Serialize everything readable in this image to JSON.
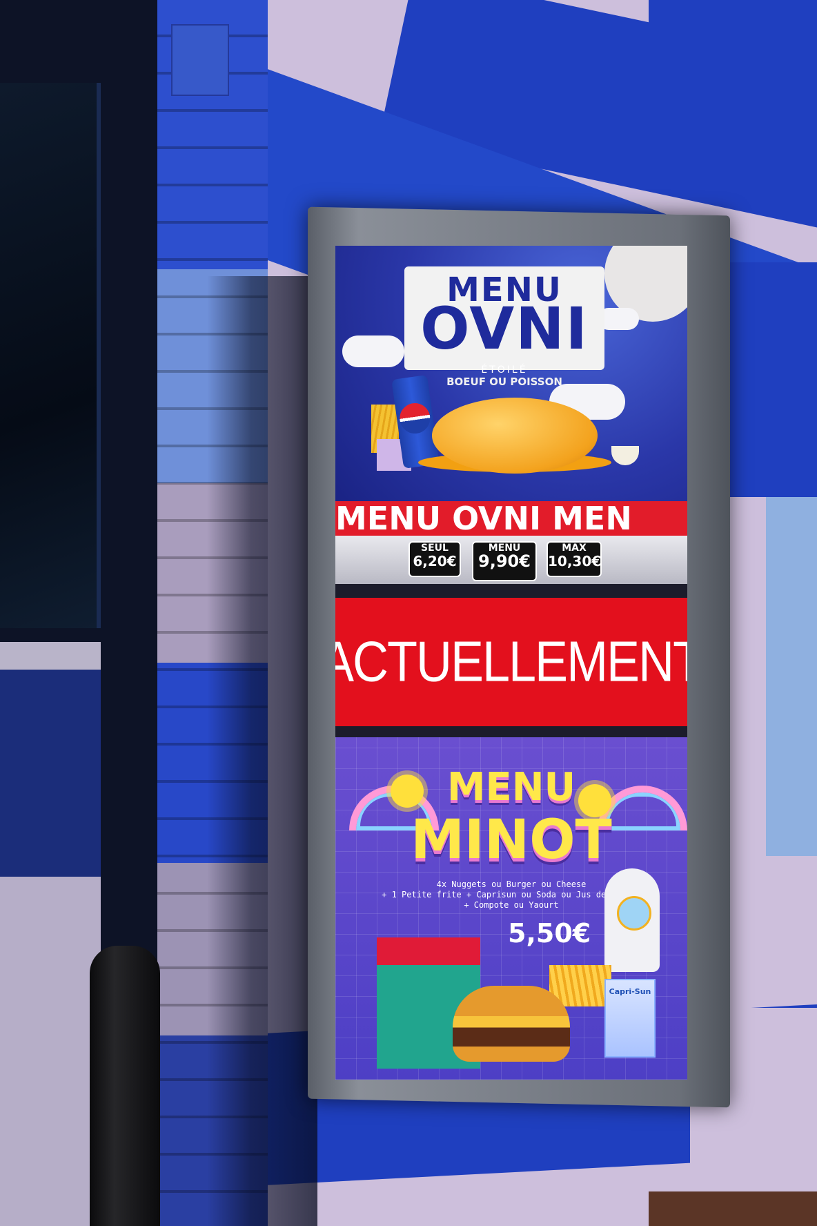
{
  "sign": {
    "ovni": {
      "menu_word": "MENU",
      "title": "OVNI",
      "subtitle_small": "ÉTOILÉ",
      "tagline": "BOEUF OU POISSON",
      "band_text": "MENU OVNI MEN",
      "can_brand": "PEPSI",
      "prices": [
        {
          "label": "SEUL",
          "value": "6,20€"
        },
        {
          "label": "MENU",
          "value": "9,90€"
        },
        {
          "label": "MAX",
          "value": "10,30€"
        }
      ]
    },
    "banner": "ACTUELLEMENT",
    "minot": {
      "menu_word": "MENU",
      "title": "MINOT",
      "description": [
        "4x Nuggets ou Burger ou Cheese",
        "+ 1 Petite frite + Caprisun ou Soda ou Jus de fruits",
        "+ Compote ou Yaourt"
      ],
      "price": "5,50€",
      "drink_brand": "Capri-Sun"
    }
  },
  "colors": {
    "wall_blue": "#1f3fbf",
    "wall_lavender": "#cdbfdc",
    "ovni_bg": "#2a37a8",
    "band_red": "#e21c2a",
    "banner_red": "#e3101d",
    "minot_bg": "#5a46cc",
    "minot_yellow": "#ffe84a"
  }
}
